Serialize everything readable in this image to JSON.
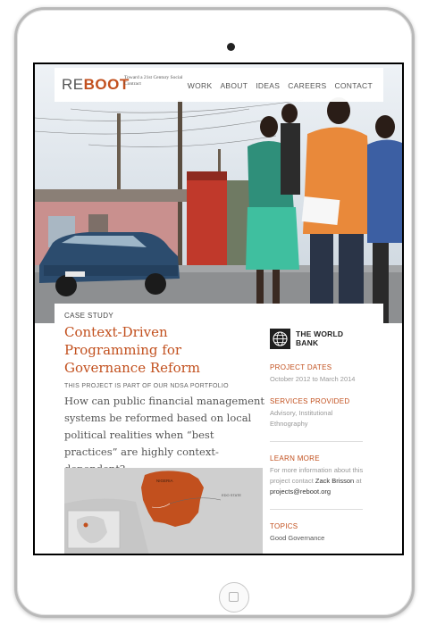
{
  "brand": {
    "logo_re": "RE",
    "logo_boot": "BOOT",
    "tagline": "Toward a 21st Century Social Contract"
  },
  "nav": {
    "items": [
      {
        "label": "WORK"
      },
      {
        "label": "ABOUT"
      },
      {
        "label": "IDEAS"
      },
      {
        "label": "CAREERS"
      },
      {
        "label": "CONTACT"
      }
    ]
  },
  "article": {
    "eyebrow": "CASE STUDY",
    "title": "Context-Driven Programming for Governance Reform",
    "portfolio_note": "THIS PROJECT IS PART OF OUR NDSA PORTFOLIO",
    "question": "How can public financial management systems be reformed based on local political realities when “best practices” are highly context-dependent?"
  },
  "map": {
    "country_label": "NIGERIA",
    "state_label": "EDO STATE"
  },
  "sidebar": {
    "partner": "THE WORLD BANK",
    "project_dates_label": "PROJECT DATES",
    "project_dates_value": "October 2012 to March 2014",
    "services_label": "SERVICES PROVIDED",
    "services_value": "Advisory, Institutional Ethnography",
    "learn_more_label": "LEARN MORE",
    "learn_more_text": "For more information about this project contact ",
    "contact_name": "Zack Brisson",
    "at_text": " at ",
    "contact_email": "projects@reboot.org",
    "topics_label": "TOPICS",
    "topics_value": "Good Governance"
  },
  "colors": {
    "accent": "#c2501e",
    "text": "#555555",
    "muted": "#999999"
  },
  "icons": {
    "world_bank_logo": "globe-icon",
    "home_button": "home-button-icon"
  }
}
